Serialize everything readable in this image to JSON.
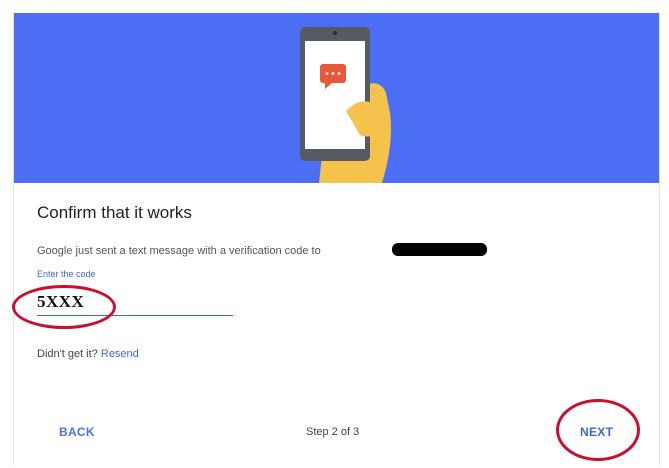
{
  "colors": {
    "banner": "#4b6ef5",
    "accent": "#3b68d8",
    "chat_bubble": "#e8593a",
    "hand": "#f5c24b",
    "highlight_ring": "#c8102e"
  },
  "banner": {
    "illustration": "phone-in-hand-icon"
  },
  "page": {
    "title": "Confirm that it works",
    "description": "Google just sent a text message with a verification code to"
  },
  "code_field": {
    "label": "Enter the code",
    "value": "5XXX"
  },
  "resend": {
    "prompt": "Didn't get it?",
    "link": "Resend"
  },
  "footer": {
    "back": "BACK",
    "step": "Step 2 of 3",
    "next": "NEXT"
  }
}
